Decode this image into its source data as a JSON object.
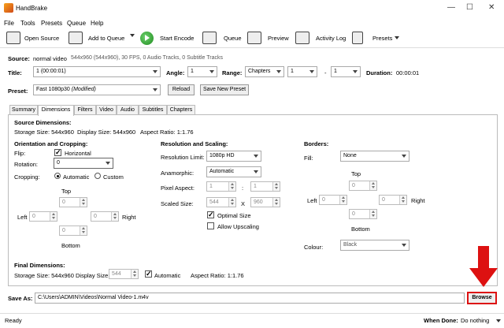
{
  "window": {
    "title": "HandBrake"
  },
  "menu": [
    "File",
    "Tools",
    "Presets",
    "Queue",
    "Help"
  ],
  "toolbar": {
    "open_source": "Open Source",
    "add_to_queue": "Add to Queue",
    "start_encode": "Start Encode",
    "queue": "Queue",
    "preview": "Preview",
    "activity_log": "Activity Log",
    "presets": "Presets"
  },
  "source": {
    "label": "Source:",
    "name": "normal video",
    "info": "544x960 (544x960), 30 FPS, 0 Audio Tracks, 0 Subtitle Tracks"
  },
  "title_row": {
    "title_label": "Title:",
    "title_value": "1 (00:00:01)",
    "angle_label": "Angle:",
    "angle_value": "1",
    "range_label": "Range:",
    "range_type": "Chapters",
    "range_start": "1",
    "range_dash": "-",
    "range_end": "1",
    "duration_label": "Duration:",
    "duration_value": "00:00:01"
  },
  "preset": {
    "label": "Preset:",
    "value": "Fast 1080p30",
    "modified": "(Modified)",
    "reload": "Reload",
    "save_new": "Save New Preset"
  },
  "tabs": [
    "Summary",
    "Dimensions",
    "Filters",
    "Video",
    "Audio",
    "Subtitles",
    "Chapters"
  ],
  "dimensions": {
    "source_title": "Source Dimensions:",
    "storage_size": "Storage Size: 544x960",
    "display_size": "Display Size: 544x960",
    "aspect_ratio": "Aspect Ratio: 1:1.76",
    "orientation_title": "Orientation and Cropping:",
    "flip_label": "Flip:",
    "flip_value": "Horizontal",
    "rotation_label": "Rotation:",
    "rotation_value": "0",
    "cropping_label": "Cropping:",
    "crop_auto": "Automatic",
    "crop_custom": "Custom",
    "top": "Top",
    "bottom": "Bottom",
    "left": "Left",
    "right": "Right",
    "crop_top": "0",
    "crop_bottom": "0",
    "crop_left": "0",
    "crop_right": "0",
    "resolution_title": "Resolution and Scaling:",
    "res_limit_label": "Resolution Limit:",
    "res_limit_value": "1080p HD",
    "anamorphic_label": "Anamorphic:",
    "anamorphic_value": "Automatic",
    "pixel_aspect_label": "Pixel Aspect:",
    "pixel_aspect_w": "1",
    "pixel_aspect_sep": ":",
    "pixel_aspect_h": "1",
    "scaled_size_label": "Scaled Size:",
    "scaled_w": "544",
    "scaled_x": "X",
    "scaled_h": "960",
    "optimal_size": "Optimal Size",
    "allow_upscaling": "Allow Upscaling",
    "borders_title": "Borders:",
    "fill_label": "Fill:",
    "fill_value": "None",
    "b_top": "0",
    "b_bottom": "0",
    "b_left": "0",
    "b_right": "0",
    "colour_label": "Colour:",
    "colour_value": "Black",
    "final_title": "Final Dimensions:",
    "final_storage": "Storage Size: 544x960",
    "final_display_label": "Display Size:",
    "final_display_value": "544",
    "final_auto": "Automatic",
    "final_aspect": "Aspect Ratio: 1:1.76"
  },
  "save": {
    "label": "Save As:",
    "path": "C:\\Users\\ADMIN\\Videos\\Normal Video-1.m4v",
    "browse": "Browse"
  },
  "status": {
    "ready": "Ready",
    "when_done_label": "When Done:",
    "when_done_value": "Do nothing"
  },
  "colors": {
    "highlight": "#dd1111"
  }
}
